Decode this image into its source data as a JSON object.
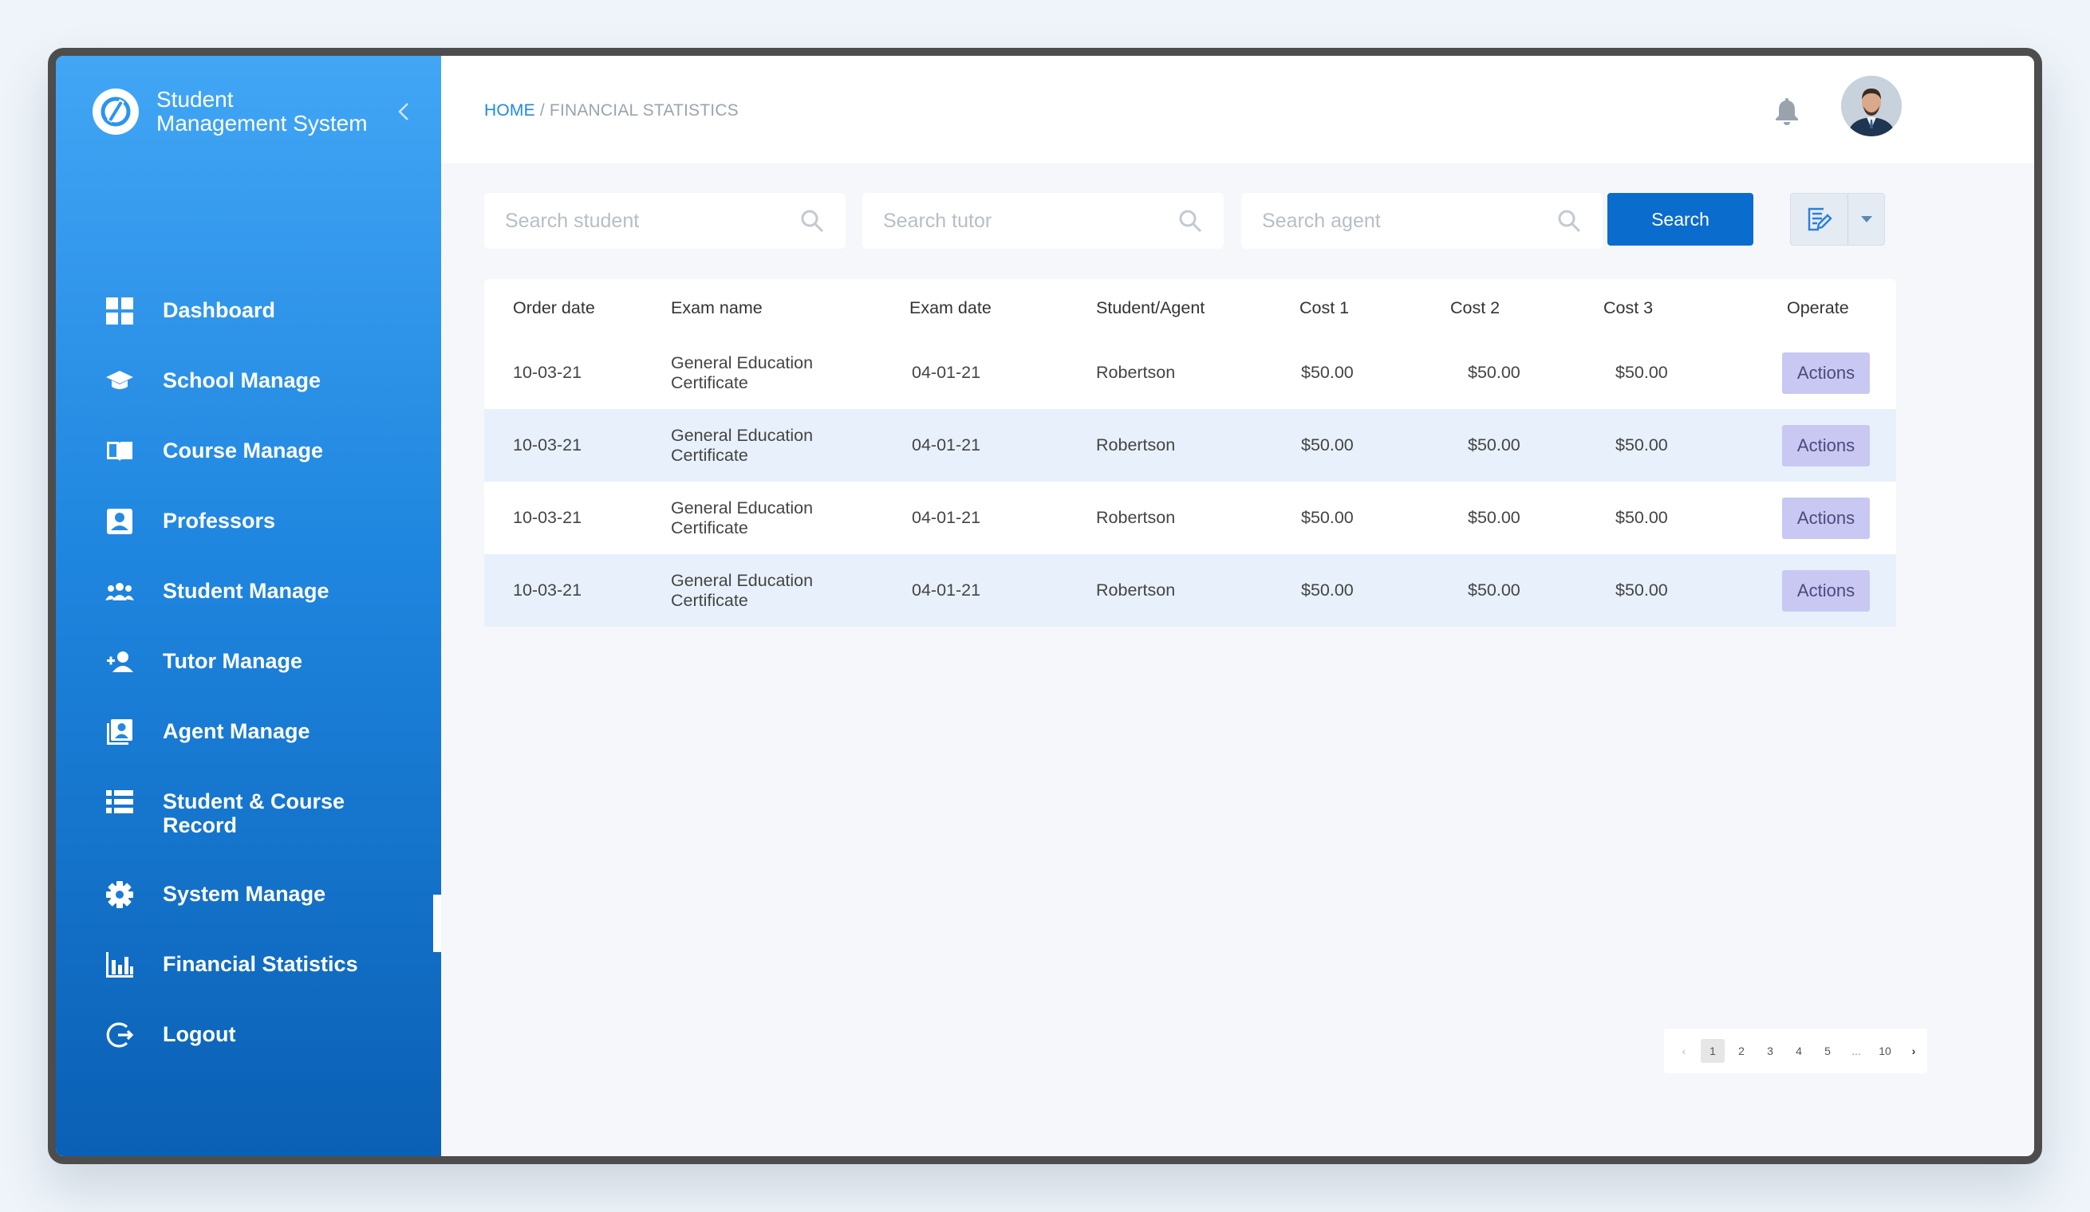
{
  "app": {
    "title": "Student Management System",
    "title_line1": "Student",
    "title_line2": "Management System"
  },
  "sidebar": {
    "items": [
      {
        "label": "Dashboard",
        "icon": "dashboard-grid-icon"
      },
      {
        "label": "School Manage",
        "icon": "graduation-cap-icon"
      },
      {
        "label": "Course Manage",
        "icon": "open-book-icon"
      },
      {
        "label": "Professors",
        "icon": "person-card-icon"
      },
      {
        "label": "Student Manage",
        "icon": "people-group-icon"
      },
      {
        "label": "Tutor Manage",
        "icon": "person-add-icon"
      },
      {
        "label": "Agent Manage",
        "icon": "contact-book-icon"
      },
      {
        "label": "Student & Course",
        "label_line2": "Record",
        "icon": "list-icon"
      },
      {
        "label": "System Manage",
        "icon": "gear-icon"
      },
      {
        "label": "Financial Statistics",
        "icon": "bar-chart-icon",
        "active": true
      },
      {
        "label": "Logout",
        "icon": "logout-icon"
      }
    ]
  },
  "header": {
    "breadcrumb": {
      "home": "HOME",
      "separator": " / ",
      "current": "FINANCIAL STATISTICS"
    }
  },
  "filters": {
    "student_placeholder": "Search student",
    "tutor_placeholder": "Search tutor",
    "agent_placeholder": "Search agent",
    "search_label": "Search"
  },
  "table": {
    "columns": [
      "Order date",
      "Exam name",
      "Exam date",
      "Student/Agent",
      "Cost 1",
      "Cost 2",
      "Cost 3",
      "Operate"
    ],
    "rows": [
      {
        "order_date": "10-03-21",
        "exam_line1": "General Education",
        "exam_line2": "Certificate",
        "exam_date": "04-01-21",
        "student": "Robertson",
        "cost1": "$50.00",
        "cost2": "$50.00",
        "cost3": "$50.00",
        "action": "Actions"
      },
      {
        "order_date": "10-03-21",
        "exam_line1": "General Education",
        "exam_line2": "Certificate",
        "exam_date": "04-01-21",
        "student": "Robertson",
        "cost1": "$50.00",
        "cost2": "$50.00",
        "cost3": "$50.00",
        "action": "Actions"
      },
      {
        "order_date": "10-03-21",
        "exam_line1": "General Education",
        "exam_line2": "Certificate",
        "exam_date": "04-01-21",
        "student": "Robertson",
        "cost1": "$50.00",
        "cost2": "$50.00",
        "cost3": "$50.00",
        "action": "Actions"
      },
      {
        "order_date": "10-03-21",
        "exam_line1": "General Education",
        "exam_line2": "Certificate",
        "exam_date": "04-01-21",
        "student": "Robertson",
        "cost1": "$50.00",
        "cost2": "$50.00",
        "cost3": "$50.00",
        "action": "Actions"
      }
    ]
  },
  "pagination": {
    "prev": "‹",
    "next": "›",
    "pages": [
      "1",
      "2",
      "3",
      "4",
      "5",
      "...",
      "10"
    ],
    "current": "1"
  },
  "colors": {
    "sidebar_top": "#42a6f5",
    "sidebar_bottom": "#0a60b5",
    "primary": "#0a6ccd",
    "breadcrumb_link": "#1e88e5",
    "actions_bg": "#c9c8f3",
    "row_alt": "#e8f1fb"
  }
}
